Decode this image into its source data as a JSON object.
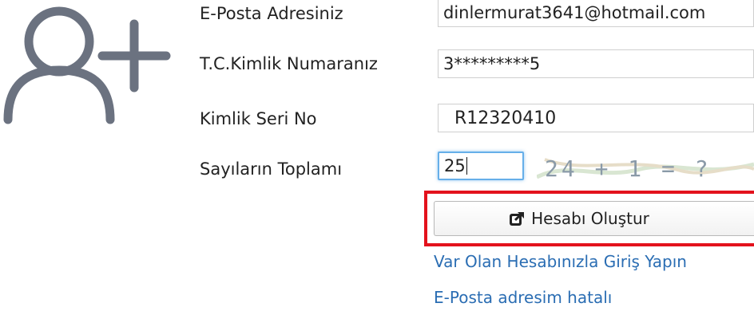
{
  "form": {
    "email_label": "E-Posta Adresiniz",
    "email_value": "dinlermurat3641@hotmail.com",
    "tc_label": "T.C.Kimlik Numaranız",
    "tc_value": "3*********5",
    "seri_label": "Kimlik Seri No",
    "seri_value": "R12320410",
    "sum_label": "Sayıların Toplamı",
    "sum_value": "25",
    "captcha_text": "24 + 1 = ?"
  },
  "actions": {
    "create_label": "Hesabı Oluştur",
    "create_icon": "external-link-icon",
    "login_link": "Var Olan Hesabınızla Giriş Yapın",
    "email_wrong_link": "E-Posta adresim hatalı"
  },
  "colors": {
    "link": "#2a6db3",
    "highlight": "#e3121c",
    "focus": "#66afe9",
    "avatar": "#6b7280"
  }
}
